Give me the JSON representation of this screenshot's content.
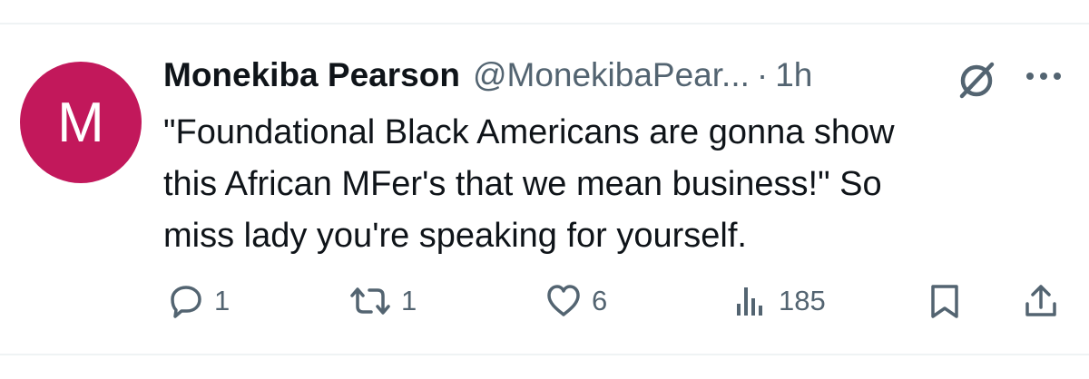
{
  "author": {
    "avatar_letter": "M",
    "display_name": "Monekiba Pearson",
    "handle": "@MonekibaPear...",
    "separator": "·",
    "time": "1h"
  },
  "tweet": {
    "lines": [
      "\"Foundational Black Americans are gonna show",
      "this African MFer's that we mean business!\" So",
      "miss lady you're speaking for yourself."
    ]
  },
  "actions": {
    "reply_count": "1",
    "retweet_count": "1",
    "like_count": "6",
    "views_count": "185"
  },
  "icons": {
    "header": [
      "grok-icon",
      "more-icon"
    ],
    "actions": [
      "reply-icon",
      "retweet-icon",
      "like-icon",
      "views-icon",
      "bookmark-icon",
      "share-icon"
    ]
  },
  "colors": {
    "avatar_bg": "#c2185b",
    "text_primary": "#0f1419",
    "text_secondary": "#536471",
    "divider": "#eff3f4"
  }
}
